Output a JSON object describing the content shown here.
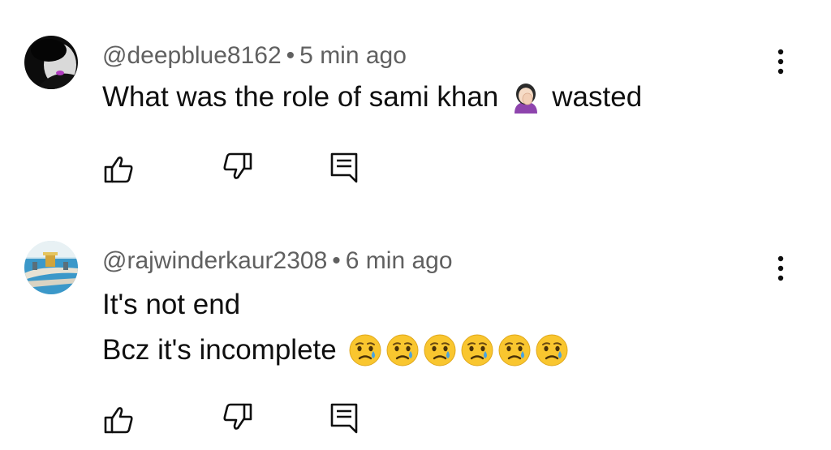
{
  "comments": [
    {
      "handle": "@deepblue8162",
      "separator": "•",
      "time": "5 min ago",
      "lines": [
        "What was the role of sami khan",
        "wasted"
      ],
      "emojis": [
        "woman-facepalming"
      ],
      "avatar_icon": "avatar-dark-portrait",
      "more_icon": "more-vert-icon"
    },
    {
      "handle": "@rajwinderkaur2308",
      "separator": "•",
      "time": "6 min ago",
      "lines": [
        "It's not end",
        "Bcz it's incomplete"
      ],
      "emojis": [
        "crying-face",
        "crying-face",
        "crying-face",
        "crying-face",
        "crying-face",
        "crying-face"
      ],
      "avatar_icon": "avatar-temple-photo",
      "more_icon": "more-vert-icon"
    }
  ],
  "actions": [
    "like-icon",
    "dislike-icon",
    "reply-icon"
  ],
  "colors": {
    "text": "#0f0f0f",
    "meta": "#606060",
    "background": "#ffffff",
    "emoji_yellow": "#f9c62f",
    "tear_blue": "#4aa3df"
  }
}
